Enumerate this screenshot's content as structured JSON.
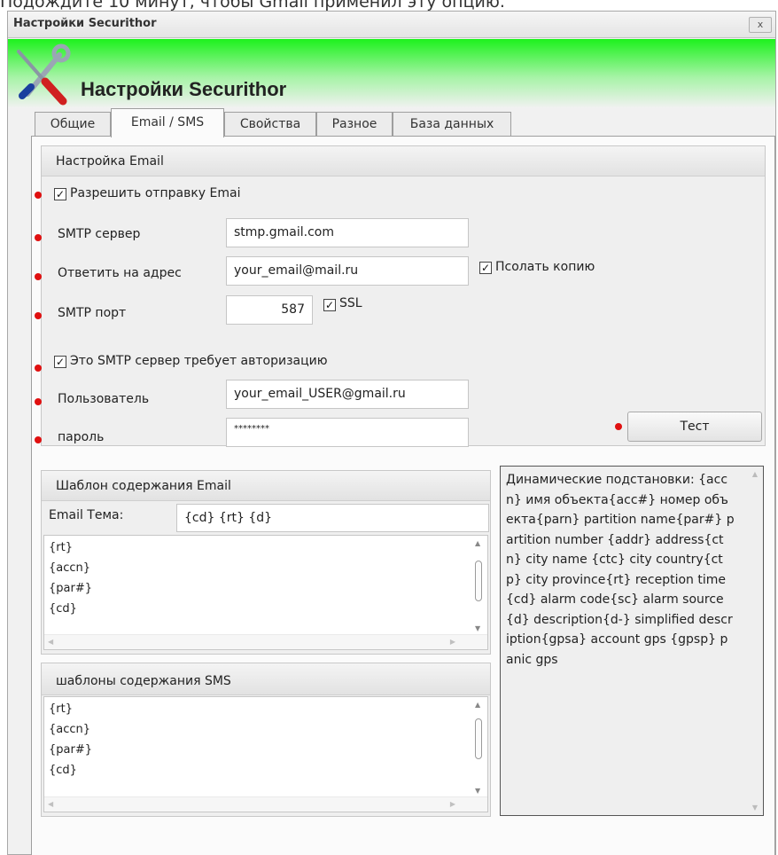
{
  "top_caption": "Подождите 10 минут, чтобы Gmail применил эту опцию.",
  "window": {
    "title": "Настройки Securithor",
    "close_label": "x"
  },
  "header": {
    "title": "Настройки Securithor",
    "logo_icon": "tools-wrench-screwdriver-icon"
  },
  "tabs": [
    {
      "label": "Общие",
      "active": false
    },
    {
      "label": "Email / SMS",
      "active": true
    },
    {
      "label": "Свойства",
      "active": false
    },
    {
      "label": "Разное",
      "active": false
    },
    {
      "label": "База данных",
      "active": false
    }
  ],
  "email_settings": {
    "header": "Настройка Email",
    "allow_sending": {
      "label": "Разрешить отправку Emai",
      "checked": true
    },
    "smtp_server": {
      "label": "SMTP сервер",
      "value": "stmp.gmail.com"
    },
    "reply_to": {
      "label": "Ответить на адрес",
      "value": "your_email@mail.ru"
    },
    "send_copy": {
      "label": "Псолать копию",
      "checked": true
    },
    "smtp_port": {
      "label": "SMTP порт",
      "value": "587"
    },
    "ssl": {
      "label": "SSL",
      "checked": true
    },
    "requires_auth": {
      "label": "Это SMTP сервер требует авторизацию",
      "checked": true
    },
    "user": {
      "label": "Пользователь",
      "value": "your_email_USER@gmail.ru"
    },
    "password": {
      "label": "пароль",
      "value": "********"
    },
    "test_button": "Тест"
  },
  "email_template": {
    "header": "Шаблон содержания Email",
    "subject_label": "Email Тема:",
    "subject_value": "{cd} {rt} {d}",
    "lines": [
      "{rt}",
      "{accn}",
      "{par#}",
      "{cd}"
    ]
  },
  "sms_template": {
    "header": "шаблоны содержания SMS",
    "lines": [
      "{rt}",
      "{accn}",
      "{par#}",
      "{cd}"
    ]
  },
  "help": {
    "text": "Динамические подстановки: {accn} имя объекта{acc#} номер объекта{parn} partition name{par#} partition number {addr} address{ctn} city name {ctc} city country{ctp} city province{rt} reception time{cd} alarm code{sc} alarm source{d} description{d-} simplified description{gpsa} account gps {gpsp} panic gps"
  },
  "colors": {
    "header_green": "#1df21d",
    "marker_red": "#e01010"
  }
}
